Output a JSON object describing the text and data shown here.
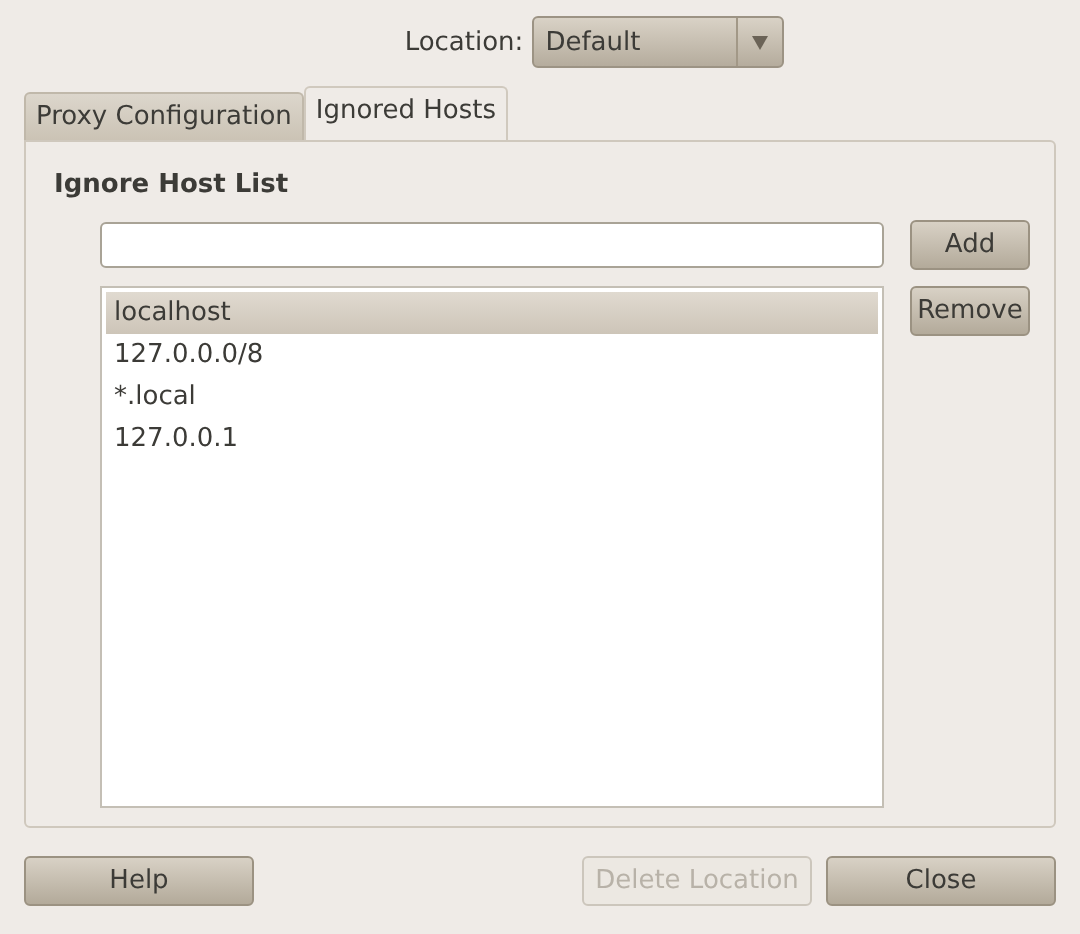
{
  "location": {
    "label": "Location:",
    "value": "Default"
  },
  "tabs": [
    {
      "label": "Proxy Configuration",
      "selected": false
    },
    {
      "label": "Ignored Hosts",
      "selected": true
    }
  ],
  "panel": {
    "heading": "Ignore Host List",
    "add_button": {
      "label": "Add",
      "disabled": false
    },
    "remove_button": {
      "label": "Remove",
      "disabled": false
    },
    "hosts": [
      {
        "label": "localhost",
        "selected": true
      },
      {
        "label": "127.0.0.0/8",
        "selected": false
      },
      {
        "label": "*.local",
        "selected": false
      },
      {
        "label": "127.0.0.1",
        "selected": false
      }
    ]
  },
  "buttons": [
    {
      "label": "Help",
      "disabled": false,
      "kind": "left"
    },
    {
      "label": "Delete Location",
      "disabled": true,
      "kind": "right"
    },
    {
      "label": "Close",
      "disabled": false,
      "kind": "right"
    }
  ]
}
